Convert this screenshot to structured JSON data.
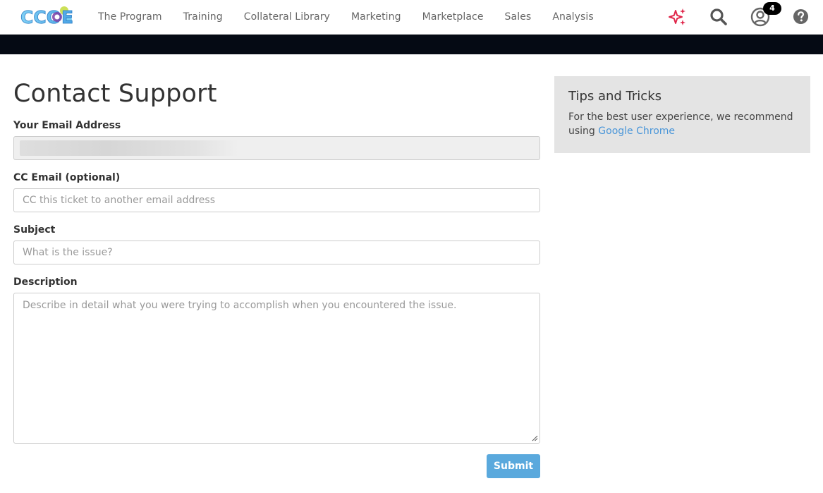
{
  "brand": {
    "logo_text": "CCOE"
  },
  "nav": {
    "items": [
      "The Program",
      "Training",
      "Collateral Library",
      "Marketing",
      "Marketplace",
      "Sales",
      "Analysis"
    ],
    "notification_count": "4"
  },
  "icons": {
    "sparkle": "sparkle-icon",
    "search": "search-icon",
    "user": "user-icon",
    "help": "help-icon"
  },
  "form": {
    "title": "Contact Support",
    "email_label": "Your Email Address",
    "email_value": "",
    "cc_label": "CC Email (optional)",
    "cc_placeholder": "CC this ticket to another email address",
    "subject_label": "Subject",
    "subject_placeholder": "What is the issue?",
    "description_label": "Description",
    "description_placeholder": "Describe in detail what you were trying to accomplish when you encountered the issue.",
    "submit_label": "Submit"
  },
  "tips": {
    "title": "Tips and Tricks",
    "body_prefix": "For the best user experience, we recommend using ",
    "link_text": "Google Chrome"
  },
  "colors": {
    "accent": "#5aa9dd",
    "link": "#4a96d9",
    "dark_bar": "#050a14",
    "sparkle": "#e0264a"
  }
}
